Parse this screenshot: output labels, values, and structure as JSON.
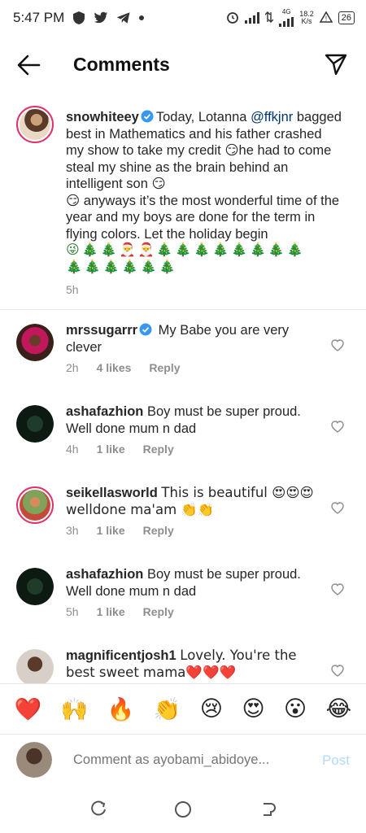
{
  "status_bar": {
    "time": "5:47 PM",
    "network_speed": "18.2",
    "network_speed_unit": "K/s",
    "network_type": "4G",
    "battery": "26"
  },
  "header": {
    "title": "Comments"
  },
  "caption": {
    "username": "snowhiteey",
    "text_1": "Today, Lotanna ",
    "mention": "@ffkjnr",
    "text_2": " bagged best in Mathematics and his father crashed my show to take my credit ",
    "emoji_smirk": "😏",
    "text_3": "he had to come steal my shine as the brain behind an intelligent son ",
    "text_4": " anyways it’s the most wonderful time of the year and my boys are done for the term in flying colors. Let the holiday begin",
    "trees_line_1": "😜🎄🎄🎅🎅🎄🎄🎄🎄🎄🎄🎄🎄",
    "trees_line_2": "🎄🎄🎄🎄🎄🎄",
    "time": "5h"
  },
  "comments": [
    {
      "username": "mrssugarrr",
      "verified": true,
      "text": "My Babe you are very clever",
      "time": "2h",
      "likes": "4 likes",
      "reply": "Reply"
    },
    {
      "username": "ashafazhion",
      "verified": false,
      "text": "Boy must be super proud. Well done mum n dad",
      "time": "4h",
      "likes": "1 like",
      "reply": "Reply"
    },
    {
      "username": "seikellasworld",
      "verified": false,
      "text": "This is beautiful 😍😍😍 welldone ma'am 👏👏",
      "time": "3h",
      "likes": "1 like",
      "reply": "Reply"
    },
    {
      "username": "ashafazhion",
      "verified": false,
      "text": "Boy must be super proud. Well done mum n dad",
      "time": "5h",
      "likes": "1 like",
      "reply": "Reply"
    },
    {
      "username": "magnificentjosh1",
      "verified": false,
      "text": "Lovely. You're the best sweet mama❤️❤️❤️",
      "time": "",
      "likes": "",
      "reply": ""
    }
  ],
  "emoji_bar": [
    "❤️",
    "🙌",
    "🔥",
    "👏",
    "😢",
    "😍",
    "😮",
    "😂"
  ],
  "comment_input": {
    "placeholder": "Comment as ayobami_abidoye...",
    "post_label": "Post"
  },
  "colors": {
    "accent_blue": "#0095f6",
    "post_disabled": "#b3dbff",
    "story_ring": "#e1306c",
    "verified": "#3897f0"
  }
}
